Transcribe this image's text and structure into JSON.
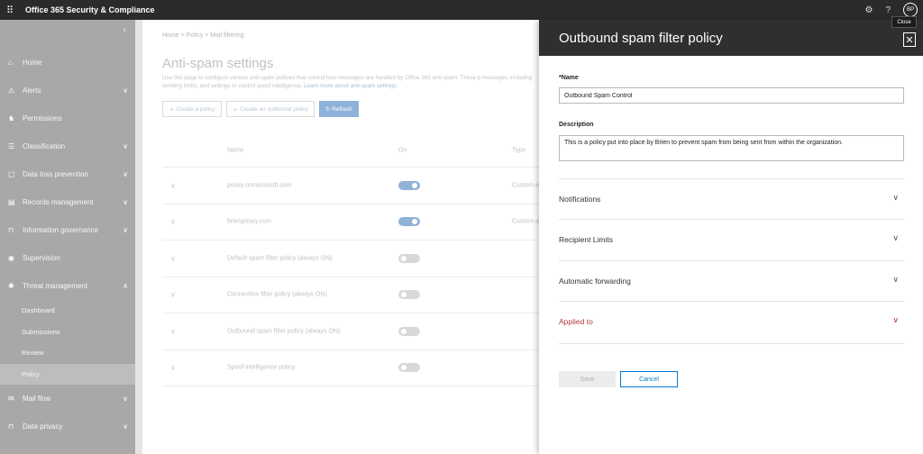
{
  "topbar": {
    "app_title": "Office 365 Security & Compliance",
    "avatar_initials": "BP",
    "help_label": "?"
  },
  "tooltip": {
    "close": "Close"
  },
  "nav": {
    "items": [
      {
        "label": "Home",
        "icon": "home-icon",
        "glyph": "⌂",
        "chevron": ""
      },
      {
        "label": "Alerts",
        "icon": "alert-icon",
        "glyph": "⚠",
        "chevron": "∨"
      },
      {
        "label": "Permissions",
        "icon": "permissions-icon",
        "glyph": "♞",
        "chevron": ""
      },
      {
        "label": "Classification",
        "icon": "classification-icon",
        "glyph": "☰",
        "chevron": "∨"
      },
      {
        "label": "Data loss prevention",
        "icon": "dlp-icon",
        "glyph": "▢",
        "chevron": "∨"
      },
      {
        "label": "Records management",
        "icon": "records-icon",
        "glyph": "▤",
        "chevron": "∨"
      },
      {
        "label": "Information governance",
        "icon": "lock-icon",
        "glyph": "⊓",
        "chevron": "∨"
      },
      {
        "label": "Supervision",
        "icon": "eye-icon",
        "glyph": "◉",
        "chevron": ""
      },
      {
        "label": "Threat management",
        "icon": "biohazard-icon",
        "glyph": "✺",
        "chevron": "∧"
      }
    ],
    "subitems": [
      "Dashboard",
      "Submissions",
      "Review",
      "Policy"
    ],
    "bottom_items": [
      {
        "label": "Mail flow",
        "icon": "mail-icon",
        "glyph": "✉",
        "chevron": "∨"
      },
      {
        "label": "Data privacy",
        "icon": "privacy-icon",
        "glyph": "⊓",
        "chevron": "∨"
      }
    ]
  },
  "main": {
    "breadcrumb": "Home  >  Policy  >  Mail filtering",
    "title": "Anti-spam settings",
    "desc": "Use this page to configure various anti-spam policies that control how messages are handled by Office 365 anti-spam. These p messages including sending limits, and settings to control spoof intelligence.",
    "desc_link": "Learn more about anti-spam settings",
    "toolbar": {
      "create": "Create a policy",
      "create_outbound": "Create an outbound policy",
      "refresh": "Refresh"
    },
    "columns": {
      "name": "Name",
      "on": "On",
      "type": "Type"
    },
    "rows": [
      {
        "name": "posey.onmicrosoft.com",
        "on": true,
        "type": "Custom a"
      },
      {
        "name": "brienposey.com",
        "on": true,
        "type": "Custom a"
      },
      {
        "name": "Default spam filter policy (always ON)",
        "on": false,
        "type": ""
      },
      {
        "name": "Connection filter policy (always ON)",
        "on": false,
        "type": ""
      },
      {
        "name": "Outbound spam filter policy (always ON)",
        "on": false,
        "type": ""
      },
      {
        "name": "Spoof intelligence policy",
        "on": false,
        "type": ""
      }
    ]
  },
  "panel": {
    "title": "Outbound spam filter policy",
    "name_label": "*Name",
    "name_value": "Outbound Spam Control",
    "desc_label": "Description",
    "desc_value": "This is a policy put into place by Brien to prevent spam from being sent from within the organization.",
    "sections": [
      "Notifications",
      "Recipient Limits",
      "Automatic forwarding",
      "Applied to"
    ],
    "save": "Save",
    "cancel": "Cancel"
  }
}
